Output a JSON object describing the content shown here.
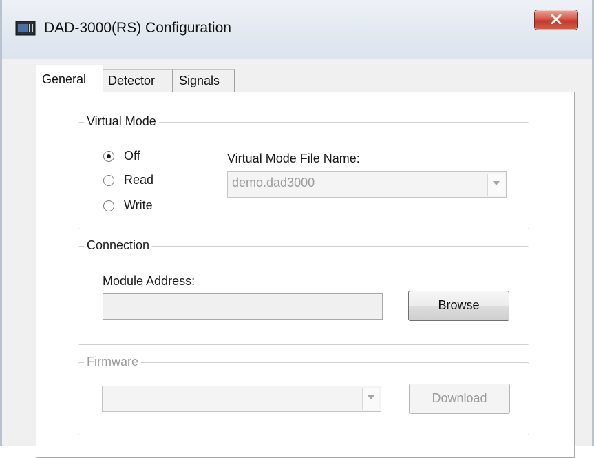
{
  "window": {
    "title": "DAD-3000(RS) Configuration"
  },
  "titlebar": {
    "icon": "device-app-icon",
    "close_icon": "close-x-icon"
  },
  "tabs": [
    {
      "label": "General",
      "selected": true
    },
    {
      "label": "Detector",
      "selected": false
    },
    {
      "label": "Signals",
      "selected": false
    }
  ],
  "virtual_mode": {
    "legend": "Virtual Mode",
    "options": [
      {
        "label": "Off",
        "checked": true
      },
      {
        "label": "Read",
        "checked": false
      },
      {
        "label": "Write",
        "checked": false
      }
    ],
    "file_label": "Virtual Mode File Name:",
    "file_value": "demo.dad3000"
  },
  "connection": {
    "legend": "Connection",
    "address_label": "Module Address:",
    "address_value": "",
    "browse_label": "Browse"
  },
  "firmware": {
    "legend": "Firmware",
    "select_value": "",
    "download_label": "Download"
  }
}
